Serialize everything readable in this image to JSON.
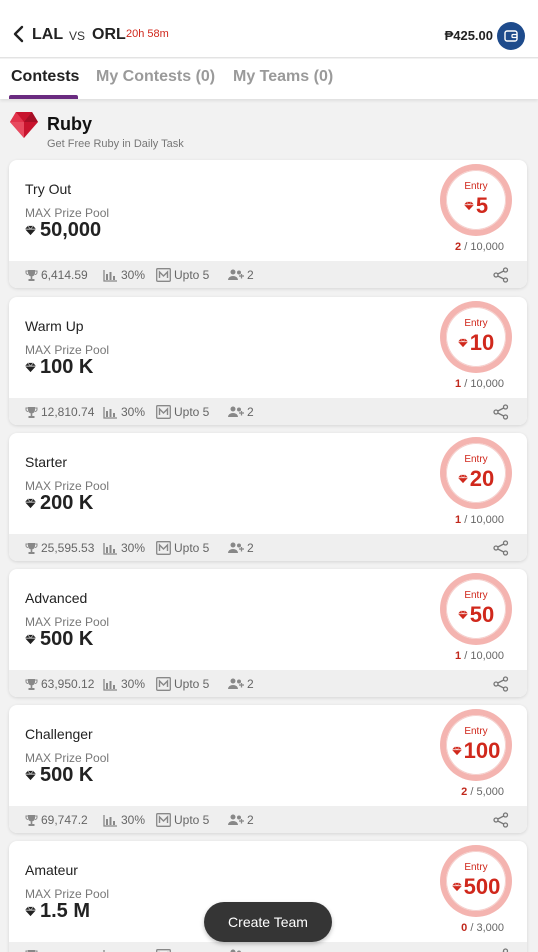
{
  "header": {
    "team_a": "LAL",
    "vs": "VS",
    "team_b": "ORL",
    "timer": "20h 58m",
    "balance": "₱425.00"
  },
  "tabs": [
    {
      "label": "Contests"
    },
    {
      "label": "My Contests (0)"
    },
    {
      "label": "My Teams (0)"
    }
  ],
  "section": {
    "title": "Ruby",
    "subtitle": "Get Free Ruby in Daily Task"
  },
  "contests": [
    {
      "name": "Try Out",
      "max_label": "MAX Prize Pool",
      "prize": "50,000",
      "entry_label": "Entry",
      "entry": "5",
      "filled": "2",
      "total": "/ 10,000",
      "first_prize": "6,414.59",
      "winners": "30%",
      "max_teams": "Upto 5",
      "teams_count": "2"
    },
    {
      "name": "Warm Up",
      "max_label": "MAX Prize Pool",
      "prize": "100 K",
      "entry_label": "Entry",
      "entry": "10",
      "filled": "1",
      "total": "/ 10,000",
      "first_prize": "12,810.74",
      "winners": "30%",
      "max_teams": "Upto 5",
      "teams_count": "2"
    },
    {
      "name": "Starter",
      "max_label": "MAX Prize Pool",
      "prize": "200 K",
      "entry_label": "Entry",
      "entry": "20",
      "filled": "1",
      "total": "/ 10,000",
      "first_prize": "25,595.53",
      "winners": "30%",
      "max_teams": "Upto 5",
      "teams_count": "2"
    },
    {
      "name": "Advanced",
      "max_label": "MAX Prize Pool",
      "prize": "500 K",
      "entry_label": "Entry",
      "entry": "50",
      "filled": "1",
      "total": "/ 10,000",
      "first_prize": "63,950.12",
      "winners": "30%",
      "max_teams": "Upto 5",
      "teams_count": "2"
    },
    {
      "name": "Challenger",
      "max_label": "MAX Prize Pool",
      "prize": "500 K",
      "entry_label": "Entry",
      "entry": "100",
      "filled": "2",
      "total": "/ 5,000",
      "first_prize": "69,747.2",
      "winners": "30%",
      "max_teams": "Upto 5",
      "teams_count": "2"
    },
    {
      "name": "Amateur",
      "max_label": "MAX Prize Pool",
      "prize": "1.5 M",
      "entry_label": "Entry",
      "entry": "500",
      "filled": "0",
      "total": "/ 3,000",
      "first_prize": "",
      "winners": "",
      "max_teams": "",
      "teams_count": ""
    }
  ],
  "create_team": {
    "label": "Create Team"
  },
  "colors": {
    "accent": "#d0281c",
    "tab_indicator": "#6a2b80",
    "wallet": "#1e4b8c",
    "button": "#353535"
  }
}
